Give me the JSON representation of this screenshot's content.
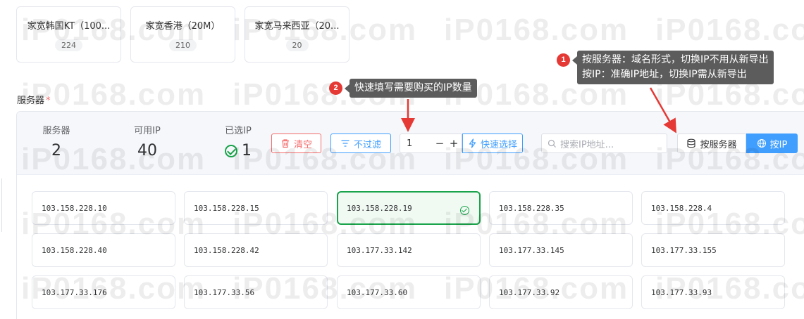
{
  "packages": [
    {
      "name": "家宽韩国KT（100...",
      "count": "224"
    },
    {
      "name": "家宽香港（20M）",
      "count": "210"
    },
    {
      "name": "家宽马来西亚（20...",
      "count": "20"
    }
  ],
  "section": {
    "label": "服务器",
    "required_mark": "*"
  },
  "stats": {
    "servers_label": "服务器",
    "servers_value": "2",
    "available_label": "可用IP",
    "available_value": "40",
    "selected_label": "已选IP",
    "selected_value": "1"
  },
  "toolbar": {
    "clear_label": "清空",
    "filter_label": "不过滤",
    "quantity_value": "1",
    "quick_select_label": "快速选择",
    "search_placeholder": "搜索IP地址...",
    "by_server_label": "按服务器",
    "by_ip_label": "按IP"
  },
  "ip_rows": [
    [
      "103.158.228.10",
      "103.158.228.15",
      "103.158.228.19",
      "103.158.228.35",
      "103.158.228.4"
    ],
    [
      "103.158.228.40",
      "103.158.228.42",
      "103.177.33.142",
      "103.177.33.145",
      "103.177.33.155"
    ],
    [
      "103.177.33.176",
      "103.177.33.56",
      "103.177.33.60",
      "103.177.33.92",
      "103.177.33.93"
    ]
  ],
  "annotations": {
    "tip1_number": "1",
    "tip1_line1": "按服务器：域名形式，切换IP不用从新导出",
    "tip1_line2": "按IP：准确IP地址，切换IP需从新导出",
    "tip2_number": "2",
    "tip2_text": "快速填写需要购买的IP数量"
  },
  "watermark": "iP0168.com",
  "colors": {
    "primary": "#409eff",
    "danger": "#f56c6c",
    "success": "#19a34a",
    "tooltip": "#5c5c5c",
    "badge": "#e53935"
  }
}
